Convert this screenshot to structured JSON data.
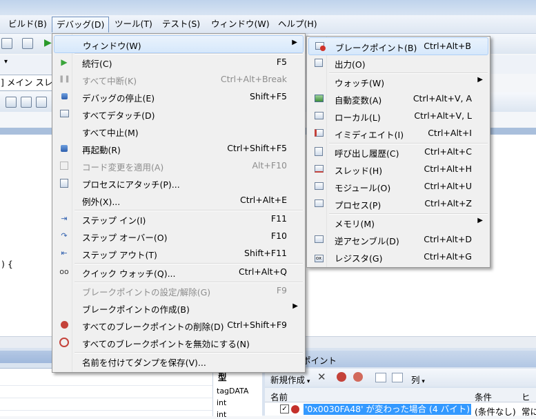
{
  "menubar": {
    "items": [
      "ビルド(B)",
      "デバッグ(D)",
      "ツール(T)",
      "テスト(S)",
      "ウィンドウ(W)",
      "ヘルプ(H)"
    ]
  },
  "background": {
    "stack_frame_fragment": "] メイン スレ",
    "code_fragment": ") {",
    "locals": {
      "type_header": "型",
      "types": [
        "tagDATA",
        "int",
        "int"
      ]
    },
    "breakpoints": {
      "title_fragment": "ポイント",
      "new_label": "新規作成",
      "columns_label": "列",
      "col_name": "名前",
      "col_condition": "条件",
      "col_hit": "ヒッ",
      "row_name": "'0x0030FA48' が変わった場合 (4 バイト)",
      "row_condition": "(条件なし)",
      "row_hit": "常に"
    }
  },
  "debug_menu": {
    "items": [
      {
        "label": "ウィンドウ(W)",
        "shortcut": "",
        "submenu": true,
        "icon": "none",
        "enabled": true,
        "highlighted": true
      },
      {
        "label": "続行(C)",
        "shortcut": "F5",
        "icon": "play-icon",
        "enabled": true
      },
      {
        "label": "すべて中断(K)",
        "shortcut": "Ctrl+Alt+Break",
        "icon": "pause-icon",
        "enabled": false
      },
      {
        "label": "デバッグの停止(E)",
        "shortcut": "Shift+F5",
        "icon": "stop-icon",
        "enabled": true
      },
      {
        "label": "すべてデタッチ(D)",
        "shortcut": "",
        "icon": "detach-icon",
        "enabled": true
      },
      {
        "label": "すべて中止(M)",
        "shortcut": "",
        "icon": "none",
        "enabled": true
      },
      {
        "label": "再起動(R)",
        "shortcut": "Ctrl+Shift+F5",
        "icon": "restart-icon",
        "enabled": true
      },
      {
        "label": "コード変更を適用(A)",
        "shortcut": "Alt+F10",
        "icon": "apply-code-icon",
        "enabled": false
      },
      {
        "label": "プロセスにアタッチ(P)...",
        "shortcut": "",
        "icon": "attach-process-icon",
        "enabled": true
      },
      {
        "label": "例外(X)...",
        "shortcut": "Ctrl+Alt+E",
        "icon": "none",
        "enabled": true
      },
      {
        "label": "ステップ イン(I)",
        "shortcut": "F11",
        "icon": "step-into-icon",
        "enabled": true
      },
      {
        "label": "ステップ オーバー(O)",
        "shortcut": "F10",
        "icon": "step-over-icon",
        "enabled": true
      },
      {
        "label": "ステップ アウト(T)",
        "shortcut": "Shift+F11",
        "icon": "step-out-icon",
        "enabled": true
      },
      {
        "label": "クイック ウォッチ(Q)...",
        "shortcut": "Ctrl+Alt+Q",
        "icon": "quick-watch-icon",
        "enabled": true
      },
      {
        "label": "ブレークポイントの設定/解除(G)",
        "shortcut": "F9",
        "icon": "none",
        "enabled": false
      },
      {
        "label": "ブレークポイントの作成(B)",
        "shortcut": "",
        "submenu": true,
        "icon": "none",
        "enabled": true
      },
      {
        "label": "すべてのブレークポイントの削除(D)",
        "shortcut": "Ctrl+Shift+F9",
        "icon": "delete-breakpoints-icon",
        "enabled": true
      },
      {
        "label": "すべてのブレークポイントを無効にする(N)",
        "shortcut": "",
        "icon": "disable-breakpoints-icon",
        "enabled": true
      },
      {
        "label": "名前を付けてダンプを保存(V)...",
        "shortcut": "",
        "icon": "none",
        "enabled": true
      }
    ]
  },
  "window_menu": {
    "items": [
      {
        "label": "ブレークポイント(B)",
        "shortcut": "Ctrl+Alt+B",
        "icon": "breakpoints-window-icon",
        "highlighted": true
      },
      {
        "label": "出力(O)",
        "shortcut": "",
        "icon": "output-icon"
      },
      {
        "label": "ウォッチ(W)",
        "shortcut": "",
        "submenu": true,
        "icon": "none"
      },
      {
        "label": "自動変数(A)",
        "shortcut": "Ctrl+Alt+V, A",
        "icon": "autos-icon"
      },
      {
        "label": "ローカル(L)",
        "shortcut": "Ctrl+Alt+V, L",
        "icon": "locals-icon"
      },
      {
        "label": "イミディエイト(I)",
        "shortcut": "Ctrl+Alt+I",
        "icon": "immediate-icon"
      },
      {
        "label": "呼び出し履歴(C)",
        "shortcut": "Ctrl+Alt+C",
        "icon": "call-stack-icon"
      },
      {
        "label": "スレッド(H)",
        "shortcut": "Ctrl+Alt+H",
        "icon": "threads-icon"
      },
      {
        "label": "モジュール(O)",
        "shortcut": "Ctrl+Alt+U",
        "icon": "modules-icon"
      },
      {
        "label": "プロセス(P)",
        "shortcut": "Ctrl+Alt+Z",
        "icon": "processes-icon"
      },
      {
        "label": "メモリ(M)",
        "shortcut": "",
        "submenu": true,
        "icon": "none"
      },
      {
        "label": "逆アセンブル(D)",
        "shortcut": "Ctrl+Alt+D",
        "icon": "disassembly-icon"
      },
      {
        "label": "レジスタ(G)",
        "shortcut": "Ctrl+Alt+G",
        "icon": "registers-icon"
      }
    ]
  },
  "colors": {
    "highlight_fill": "#d6e8fb",
    "highlight_border": "#aecff7",
    "selection": "#3399ff",
    "disabled_text": "#8d8d8d"
  }
}
